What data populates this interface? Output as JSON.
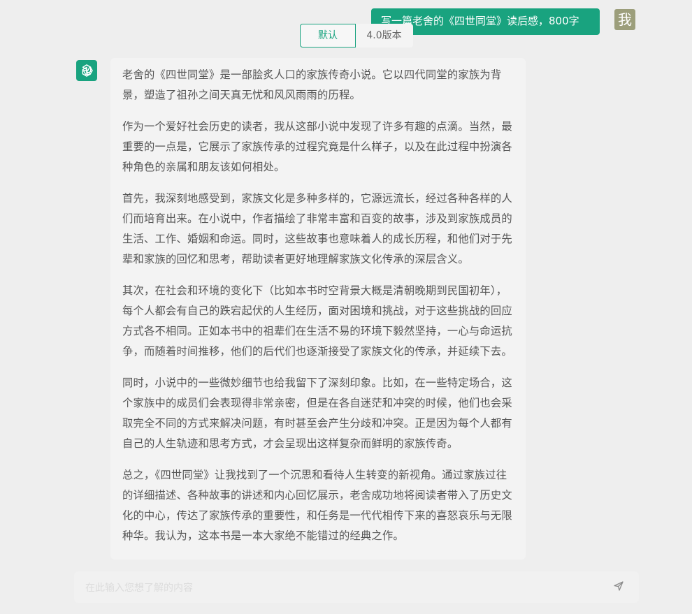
{
  "user_message": {
    "text": "写一篇老舍的《四世同堂》读后感，800字",
    "avatar_label": "我"
  },
  "version_switch": {
    "active_label": "默认",
    "other_label": "4.0版本"
  },
  "answer": {
    "paragraphs": [
      "老舍的《四世同堂》是一部脍炙人口的家族传奇小说。它以四代同堂的家族为背景，塑造了祖孙之间天真无忧和风风雨雨的历程。",
      "作为一个爱好社会历史的读者，我从这部小说中发现了许多有趣的点滴。当然，最重要的一点是，它展示了家族传承的过程究竟是什么样子，以及在此过程中扮演各种角色的亲属和朋友该如何相处。",
      "首先，我深刻地感受到，家族文化是多种多样的，它源远流长，经过各种各样的人们而培育出来。在小说中，作者描绘了非常丰富和百变的故事，涉及到家族成员的生活、工作、婚姻和命运。同时，这些故事也意味着人的成长历程，和他们对于先辈和家族的回忆和思考，帮助读者更好地理解家族文化传承的深层含义。",
      "其次，在社会和环境的变化下（比如本书时空背景大概是清朝晚期到民国初年），每个人都会有自己的跌宕起伏的人生经历，面对困境和挑战，对于这些挑战的回应方式各不相同。正如本书中的祖辈们在生活不易的环境下毅然坚持，一心与命运抗争，而随着时间推移，他们的后代们也逐渐接受了家族文化的传承，并延续下去。",
      "同时，小说中的一些微妙细节也给我留下了深刻印象。比如，在一些特定场合，这个家族中的成员们会表现得非常亲密，但是在各自迷茫和冲突的时候，他们也会采取完全不同的方式来解决问题，有时甚至会产生分歧和冲突。正是因为每个人都有自己的人生轨迹和思考方式，才会呈现出这样复杂而鲜明的家族传奇。",
      "总之，《四世同堂》让我找到了一个沉思和看待人生转变的新视角。通过家族过往的详细描述、各种故事的讲述和内心回忆展示，老舍成功地将阅读者带入了历史文化的中心，传达了家族传承的重要性，和任务是一代代相传下来的喜怒哀乐与无限种华。我认为，这本书是一本大家绝不能错过的经典之作。"
    ]
  },
  "input": {
    "value": "",
    "placeholder": "在此输入您想了解的内容"
  },
  "icons": {
    "bot_avatar": "openai-logo-icon",
    "send": "send-icon"
  },
  "colors": {
    "accent": "#19a37f",
    "user_avatar_bg": "#9c9e7b",
    "background": "#eeeeee"
  }
}
